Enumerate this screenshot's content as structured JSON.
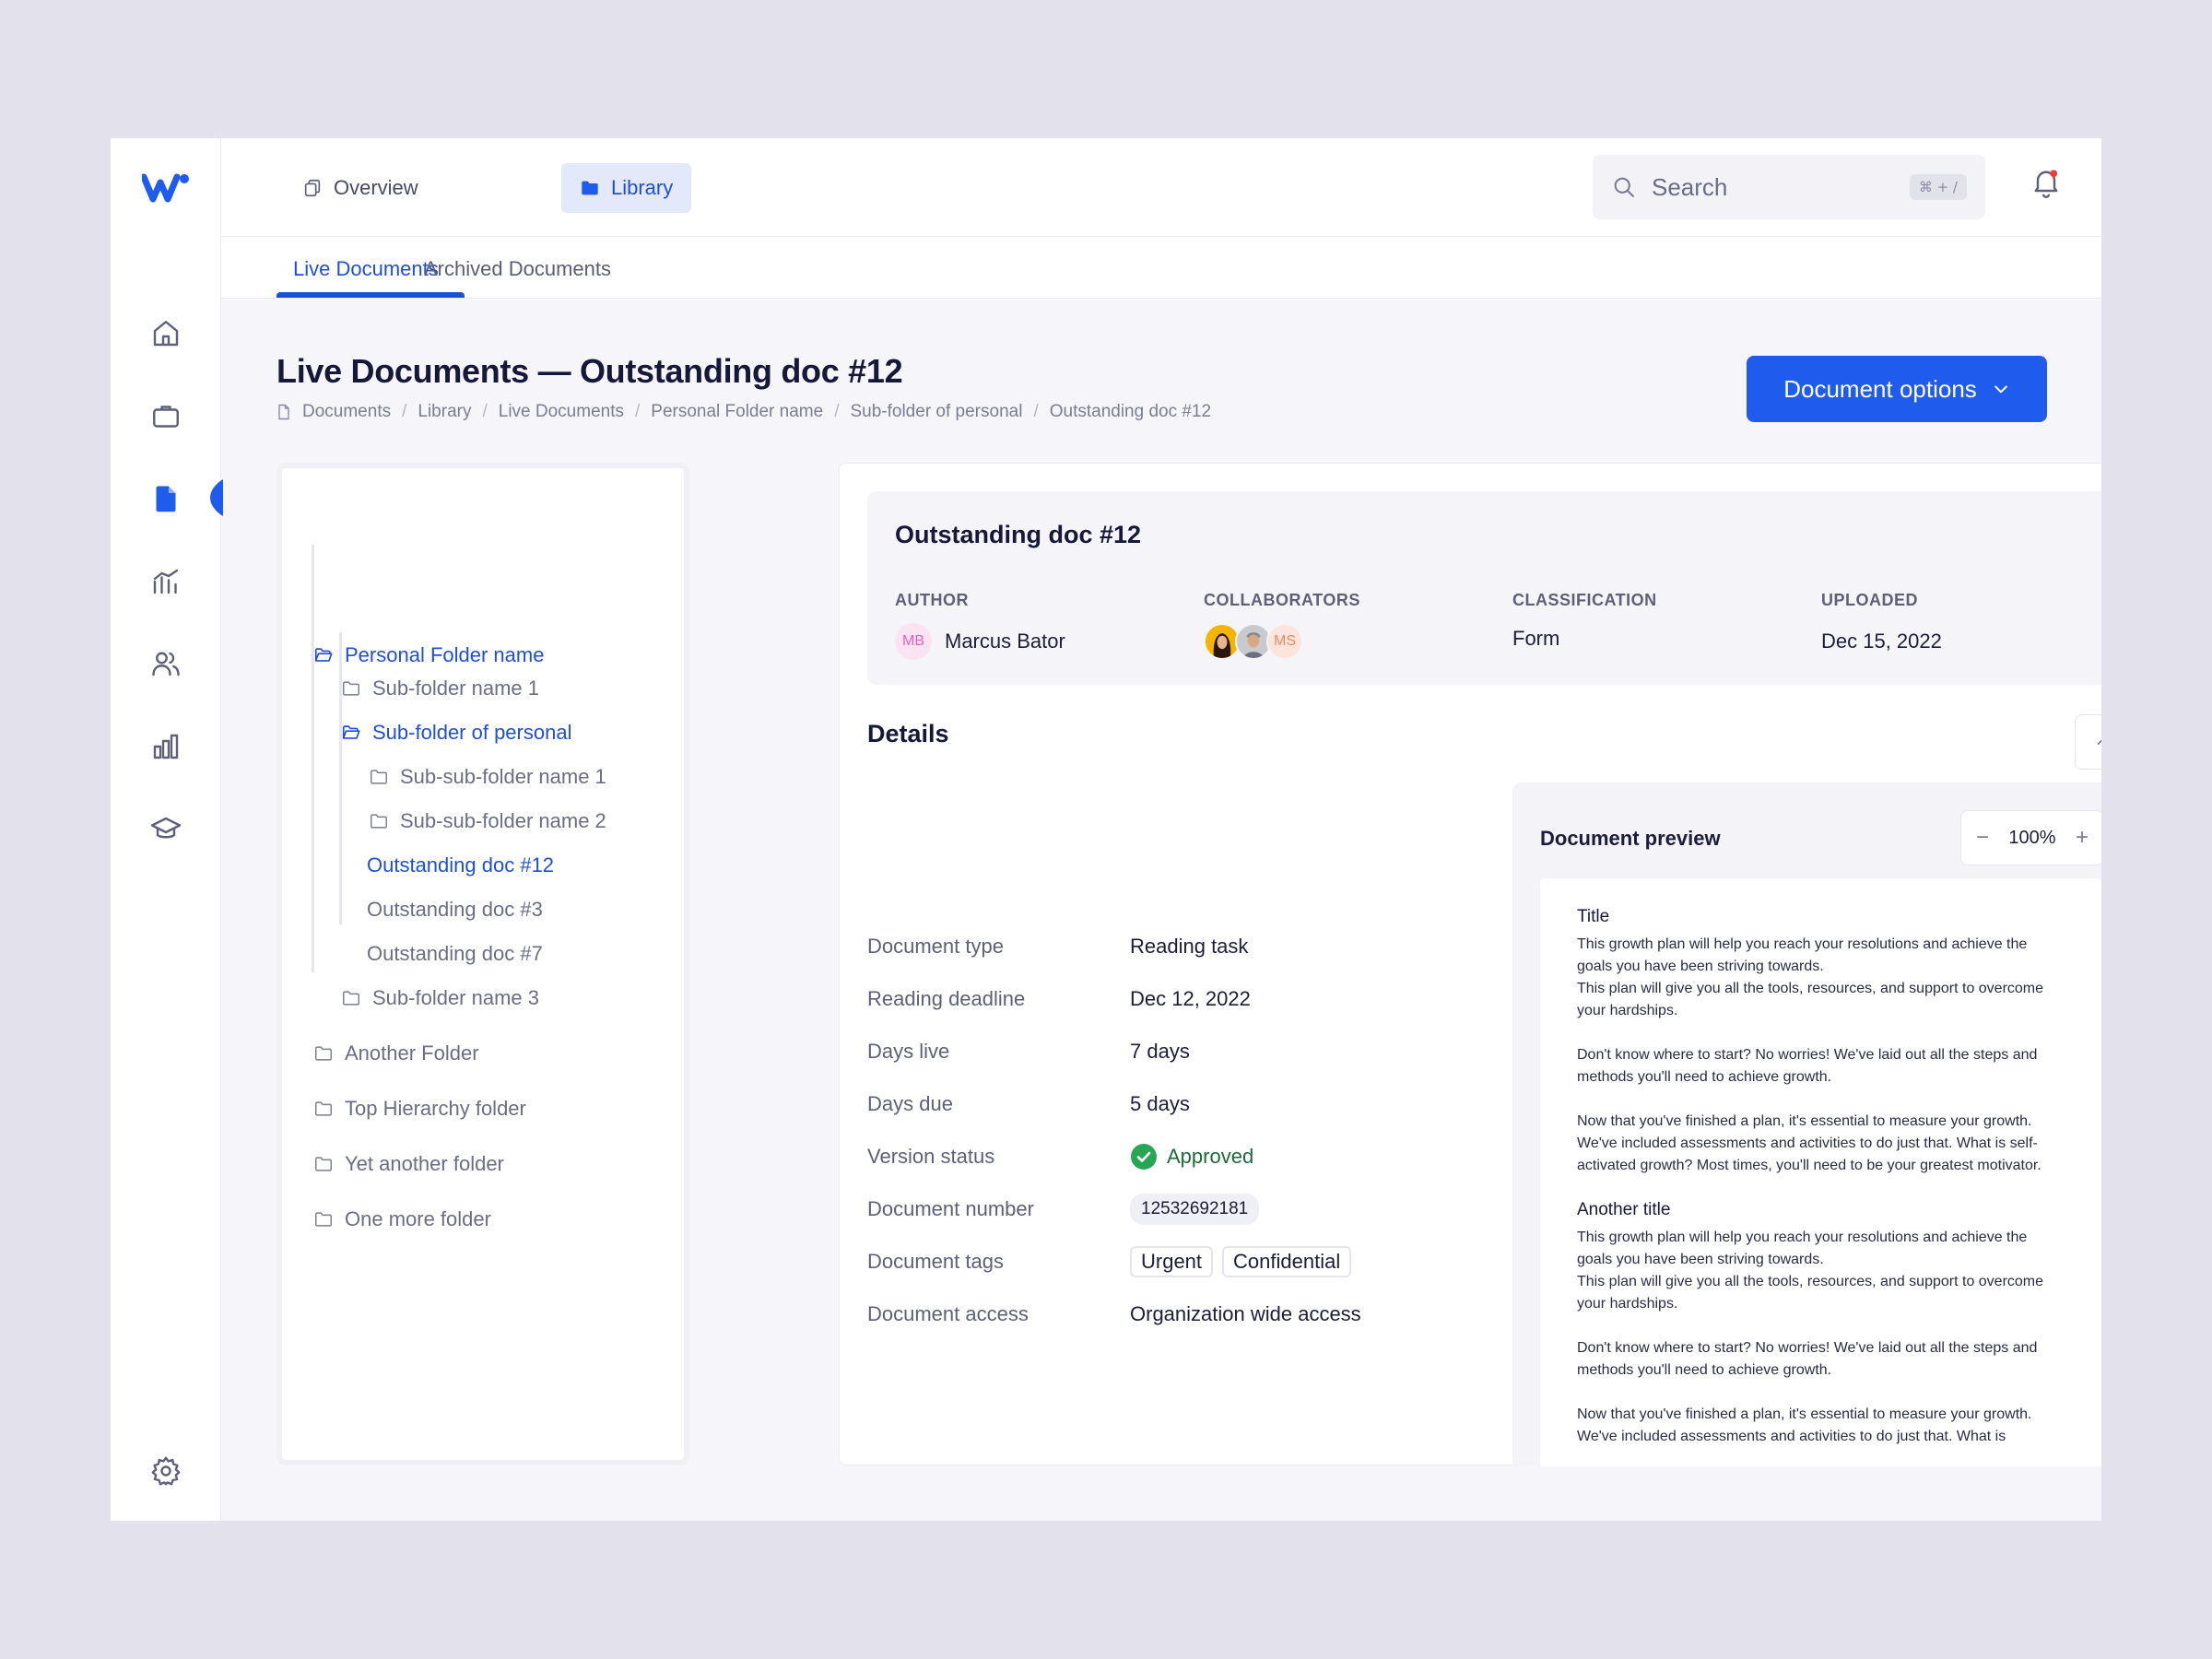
{
  "colors": {
    "accent": "#1f5bec",
    "accent_text": "#1f4fd6",
    "success": "#28a555",
    "background": "#f5f5fa"
  },
  "sidebar": {
    "icons": [
      "home-icon",
      "briefcase-icon",
      "document-icon",
      "chart-tree-icon",
      "users-icon",
      "bar-chart-icon",
      "graduation-cap-icon",
      "settings-icon"
    ]
  },
  "header": {
    "tabs": [
      {
        "label": "Overview",
        "icon": "pages-icon"
      },
      {
        "label": "Library",
        "icon": "folder-icon"
      }
    ],
    "search": {
      "placeholder": "Search",
      "shortcut": "⌘ + /"
    }
  },
  "subtabs": [
    "Live Documents",
    "Archived Documents"
  ],
  "page": {
    "title": "Live Documents — Outstanding doc #12",
    "breadcrumb": [
      "Documents",
      "Library",
      "Live Documents",
      "Personal Folder name",
      "Sub-folder of personal",
      "Outstanding doc #12"
    ],
    "options_button": "Document options"
  },
  "tree": {
    "personal": "Personal Folder name",
    "sub1": "Sub-folder name 1",
    "sub_personal": "Sub-folder of personal",
    "subsub1": "Sub-sub-folder name 1",
    "subsub2": "Sub-sub-folder name 2",
    "doc12": "Outstanding doc #12",
    "doc3": "Outstanding doc #3",
    "doc7": "Outstanding doc #7",
    "sub3": "Sub-folder name 3",
    "another": "Another Folder",
    "top": "Top Hierarchy folder",
    "yet": "Yet another folder",
    "one_more": "One more folder"
  },
  "doc": {
    "title": "Outstanding doc #12",
    "author_label": "AUTHOR",
    "author_initials": "MB",
    "author": "Marcus Bator",
    "collaborators_label": "COLLABORATORS",
    "collaborator_initials": "MS",
    "classification_label": "CLASSIFICATION",
    "classification": "Form",
    "uploaded_label": "UPLOADED",
    "uploaded": "Dec 15, 2022"
  },
  "details": {
    "title": "Details",
    "rows": [
      {
        "label": "Document type",
        "value": "Reading task"
      },
      {
        "label": "Reading deadline",
        "value": "Dec 12, 2022"
      },
      {
        "label": "Days live",
        "value": "7 days"
      },
      {
        "label": "Days due",
        "value": "5 days"
      },
      {
        "label": "Version status",
        "value": "Approved"
      },
      {
        "label": "Document number",
        "value": "12532692181"
      },
      {
        "label": "Document tags",
        "tags": [
          "Urgent",
          "Confidential"
        ]
      },
      {
        "label": "Document access",
        "value": "Organization wide access"
      }
    ]
  },
  "preview": {
    "title": "Document preview",
    "zoom": "100%",
    "h1": "Title",
    "p1a": "This growth plan will help you reach your resolutions and achieve the goals you have been striving towards.",
    "p1b": "This plan will give you all the tools, resources, and support to overcome your hardships.",
    "p2": "Don't know where to start? No worries! We've laid out all the steps and methods you'll need to achieve growth.",
    "p3": "Now that you've finished a plan, it's essential to measure your growth. We've included assessments and activities to do just that. What is self-activated growth? Most times, you'll need to be your greatest motivator.",
    "h2": "Another title",
    "p4a": "This growth plan will help you reach your resolutions and achieve the goals you have been striving towards.",
    "p4b": "This plan will give you all the tools, resources, and support to overcome your hardships.",
    "p5": "Don't know where to start? No worries! We've laid out all the steps and methods you'll need to achieve growth.",
    "p6": "Now that you've finished a plan, it's essential to measure your growth. We've included assessments and activities to do just that. What is"
  }
}
